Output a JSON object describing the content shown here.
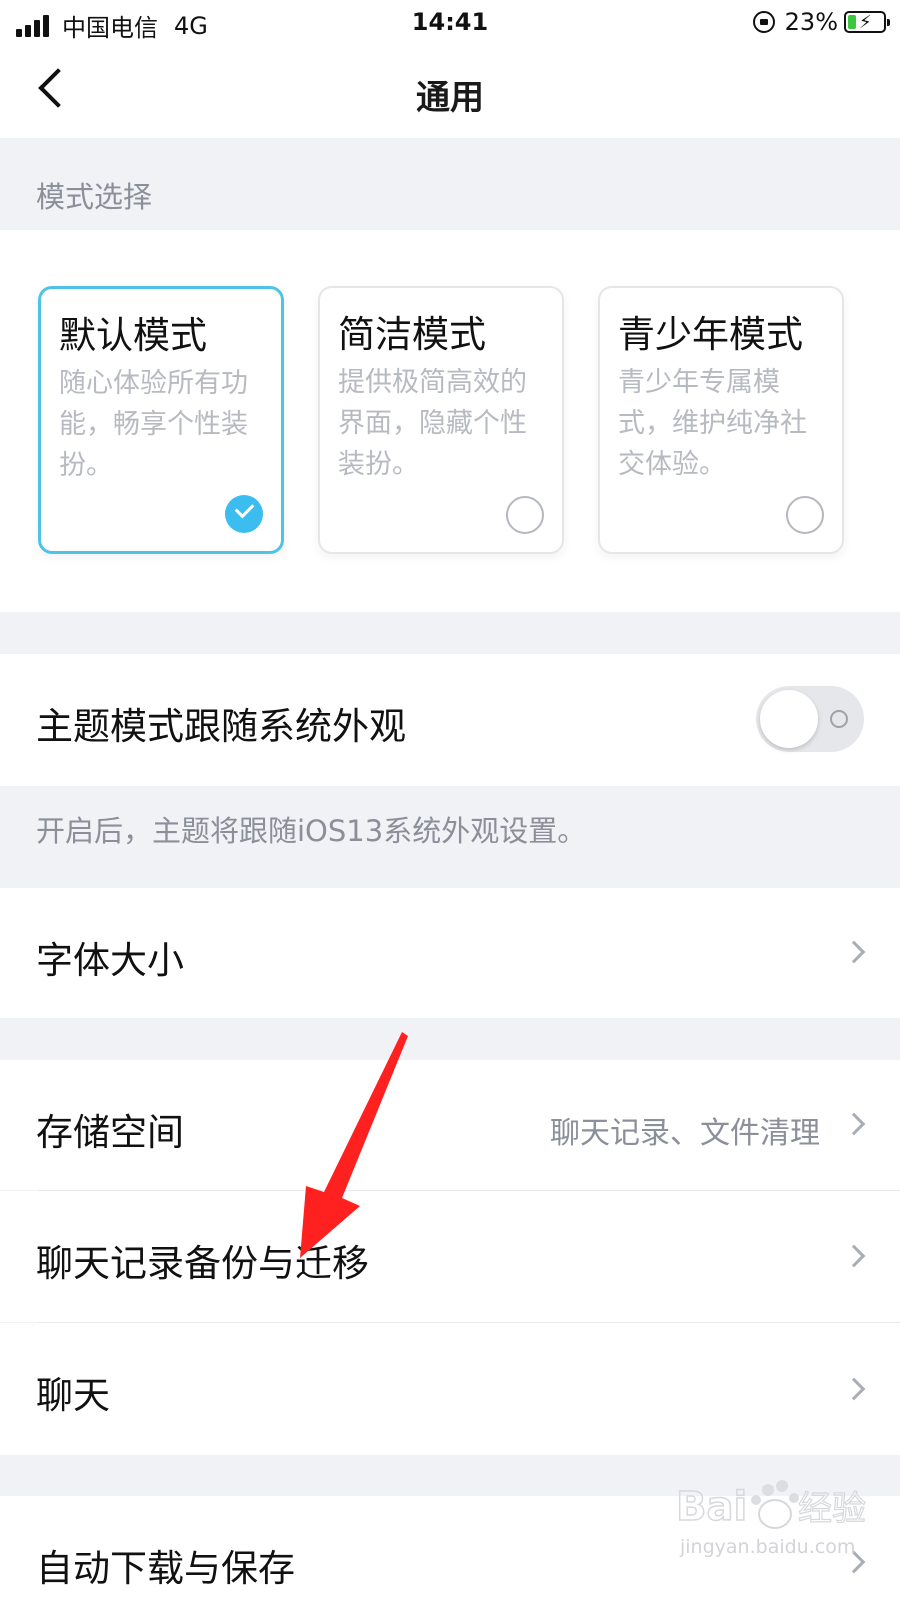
{
  "status_bar": {
    "carrier": "中国电信",
    "network": "4G",
    "time": "14:41",
    "battery": "23%",
    "battery_level": 0.23
  },
  "nav": {
    "title": "通用"
  },
  "mode_section": {
    "label": "模式选择",
    "modes": [
      {
        "title": "默认模式",
        "desc": "随心体验所有功能，畅享个性装扮。",
        "selected": true
      },
      {
        "title": "简洁模式",
        "desc": "提供极简高效的界面，隐藏个性装扮。",
        "selected": false
      },
      {
        "title": "青少年模式",
        "desc": "青少年专属模式，维护纯净社交体验。",
        "selected": false
      }
    ]
  },
  "theme_follow": {
    "label": "主题模式跟随系统外观",
    "enabled": false,
    "note": "开启后，主题将跟随iOS13系统外观设置。"
  },
  "rows": {
    "font_size": "字体大小",
    "storage": "存储空间",
    "storage_value": "聊天记录、文件清理",
    "chat_backup": "聊天记录备份与迁移",
    "chat": "聊天",
    "auto_download": "自动下载与保存"
  },
  "watermark": {
    "logo_text": "Bai",
    "logo_text2": "经验",
    "url": "jingyan.baidu.com"
  },
  "colors": {
    "accent": "#3cbdf0",
    "annotation": "#ff2020"
  }
}
